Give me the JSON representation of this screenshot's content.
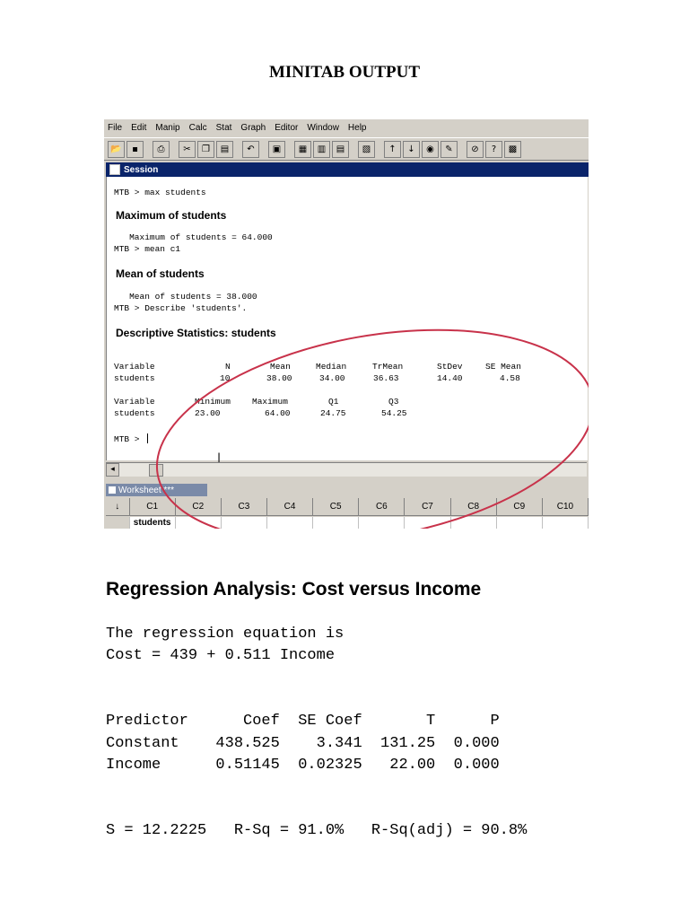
{
  "page": {
    "title": "MINITAB OUTPUT"
  },
  "menu": [
    "File",
    "Edit",
    "Manip",
    "Calc",
    "Stat",
    "Graph",
    "Editor",
    "Window",
    "Help"
  ],
  "toolbar_icons": [
    "open-icon",
    "save-icon",
    "print-icon",
    "cut-icon",
    "copy-icon",
    "paste-icon",
    "undo-icon",
    "session-window-icon",
    "worksheet-icon",
    "graph-icon",
    "info-icon",
    "clear-icon",
    "up-arrow-icon",
    "down-arrow-icon",
    "find-icon",
    "help-icon",
    "cancel-icon",
    "question-icon",
    "project-manager-icon"
  ],
  "session": {
    "title": "Session",
    "cmd1": "MTB > max students",
    "h1": "Maximum of students",
    "l1": "   Maximum of students = 64.000",
    "cmd2": "MTB > mean c1",
    "h2": "Mean of students",
    "l2": "   Mean of students = 38.000",
    "cmd3": "MTB > Describe 'students'.",
    "h3": "Descriptive Statistics: students",
    "table1": {
      "headers": [
        "Variable",
        "N",
        "Mean",
        "Median",
        "TrMean",
        "StDev",
        "SE Mean"
      ],
      "row": [
        "students",
        "10",
        "38.00",
        "34.00",
        "36.63",
        "14.40",
        "4.58"
      ]
    },
    "table2": {
      "headers": [
        "Variable",
        "Minimum",
        "Maximum",
        "Q1",
        "Q3"
      ],
      "row": [
        "students",
        "23.00",
        "64.00",
        "24.75",
        "54.25"
      ]
    },
    "prompt": "MTB > "
  },
  "worksheet": {
    "title": "Worksheet ***",
    "columns": [
      "↓",
      "C1",
      "C2",
      "C3",
      "C4",
      "C5",
      "C6",
      "C7",
      "C8",
      "C9",
      "C10"
    ],
    "names": [
      "",
      "students",
      "",
      "",
      "",
      "",
      "",
      "",
      "",
      "",
      ""
    ]
  },
  "regression": {
    "title": "Regression Analysis: Cost versus Income",
    "eq_intro": "The regression equation is",
    "equation": "Cost = 439 + 0.511 Income",
    "table_header": "Predictor      Coef  SE Coef       T      P",
    "row1": "Constant    438.525    3.341  131.25  0.000",
    "row2": "Income      0.51145  0.02325   22.00  0.000",
    "summary": "S = 12.2225   R-Sq = 91.0%   R-Sq(adj) = 90.8%"
  },
  "colors": {
    "annotation_circle": "#c8324a",
    "title_bar": "#0a246a"
  }
}
